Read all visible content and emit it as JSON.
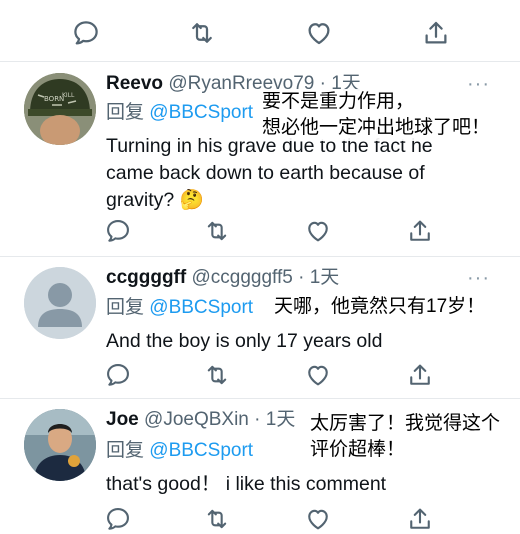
{
  "icons": {
    "reply": "comment-bubble-icon",
    "retweet": "retweet-arrows-icon",
    "like": "heart-icon",
    "share": "share-upload-icon",
    "more": "more-dots-icon"
  },
  "colors": {
    "icon": "#536471",
    "link": "#1d9bf0",
    "divider": "#e6e9ec"
  },
  "tweets": [
    {
      "name": "Reevo",
      "handle": "@RyanRreevo79 · 1天",
      "reply_prefix": "回复",
      "mention": "@BBCSport",
      "text": "Turning in his grave due to the fact he came back down to earth because of gravity? 🤔",
      "more": "···",
      "overlay": [
        "要不是重力作用，",
        "想必他一定冲出地球了吧！"
      ]
    },
    {
      "name": "ccggggff",
      "handle": "@ccggggff5 · 1天",
      "reply_prefix": "回复",
      "mention": "@BBCSport",
      "text": "And the boy is only 17 years old",
      "more": "···",
      "overlay": [
        "天哪，他竟然只有17岁！"
      ]
    },
    {
      "name": "Joe",
      "handle": "@JoeQBXin · 1天",
      "reply_prefix": "回复",
      "mention": "@BBCSport",
      "text": "that's good！ i like this comment",
      "more": "",
      "overlay": [
        "太厉害了！我觉得这个",
        "评价超棒！"
      ]
    }
  ]
}
